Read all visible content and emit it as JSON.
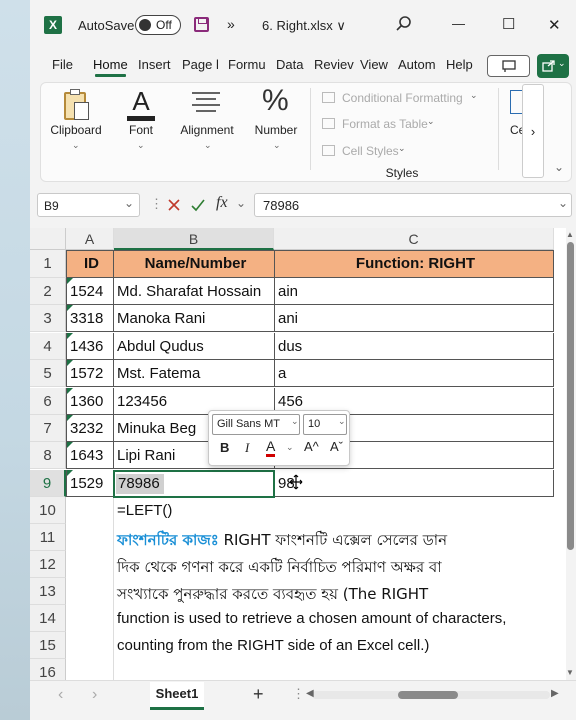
{
  "titlebar": {
    "logo": "X",
    "autosave": "AutoSave",
    "toggle": "Off",
    "more": "»",
    "file": "6. Right.xlsx ∨",
    "search_icon": "search-icon",
    "min": "—",
    "max": "☐",
    "close": "✕"
  },
  "tabs": [
    "File",
    "Home",
    "Insert",
    "Page l",
    "Formu",
    "Data",
    "Reviev",
    "View",
    "Autom",
    "Help"
  ],
  "ribbon": {
    "clipboard": "Clipboard",
    "font": "Font",
    "alignment": "Alignment",
    "number": "Number",
    "percent": "%",
    "cond": "Conditional Formatting",
    "table": "Format as Table",
    "cellstyles": "Cell Styles",
    "styles": "Styles",
    "cells": "Ce"
  },
  "formula": {
    "namebox": "B9",
    "value": "78986",
    "fx": "fx"
  },
  "columns": [
    "A",
    "B",
    "C"
  ],
  "header": [
    "ID",
    "Name/Number",
    "Function: RIGHT"
  ],
  "rows": [
    {
      "n": "2",
      "id": "1524",
      "name": "Md. Sharafat Hossain",
      "res": "ain"
    },
    {
      "n": "3",
      "id": "3318",
      "name": "Manoka Rani",
      "res": "ani"
    },
    {
      "n": "4",
      "id": "1436",
      "name": "Abdul Qudus",
      "res": "dus"
    },
    {
      "n": "5",
      "id": "1572",
      "name": "Mst. Fatema",
      "res": "a"
    },
    {
      "n": "6",
      "id": "1360",
      "name": "123456",
      "res": "456"
    },
    {
      "n": "7",
      "id": "3232",
      "name": "Minuka  Beg",
      "res": ""
    },
    {
      "n": "8",
      "id": "1643",
      "name": "Lipi  Rani",
      "res": ""
    },
    {
      "n": "9",
      "id": "1529",
      "name": "78986",
      "res": "98"
    }
  ],
  "extra_rows": [
    "10",
    "11",
    "12",
    "13",
    "14",
    "15",
    "16"
  ],
  "minitb": {
    "font": "Gill Sans MT",
    "size": "10",
    "b": "B",
    "i": "I",
    "a": "A",
    "grow": "A^",
    "shrink": "Aˇ"
  },
  "notes": {
    "r10": "=LEFT()",
    "r11a": "ফাংশনটির কাজঃ",
    "r11b": " RIGHT ফাংশনটি এক্সেল সেলের ডান",
    "r12": "দিক থেকে গণনা করে একটি নির্বাচিত পরিমাণ অক্ষর বা",
    "r13": "সংখ্যাকে পুনরুদ্ধার করতে ব্যবহৃত হয় (The RIGHT",
    "r14": "function is used to retrieve a chosen amount of characters,",
    "r15": "counting from the RIGHT side of an Excel cell.)"
  },
  "sheettab": "Sheet1",
  "addsheet": "+",
  "colors": {
    "header_fill": "#f4b183",
    "accent": "#1e7145"
  }
}
